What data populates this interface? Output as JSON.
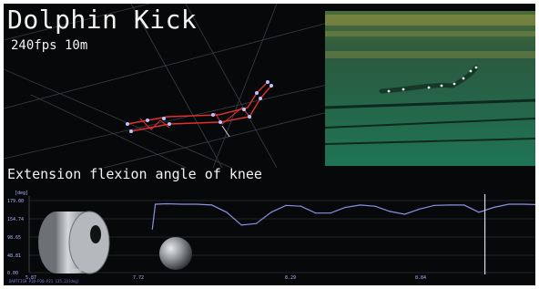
{
  "overlay": {
    "title": "Dolphin Kick",
    "subtitle": "240fps 10m",
    "section_label": "Extension flexion angle of knee"
  },
  "chart_data": {
    "type": "line",
    "ylabel": "[deg]",
    "y_ticks": [
      "179.00",
      "154.74",
      "98.65",
      "48.81",
      "0.00"
    ],
    "x_ticks": [
      "5.87",
      "7.72",
      "8.29",
      "8.84"
    ],
    "xlim": [
      5.87,
      9.28
    ],
    "ylim": [
      0,
      179
    ],
    "series": [
      {
        "x": [
          6.7,
          6.72,
          6.8,
          6.9,
          7.0,
          7.1,
          7.2,
          7.3,
          7.4,
          7.5,
          7.6,
          7.7,
          7.8,
          7.9,
          8.0,
          8.1,
          8.2,
          8.3,
          8.4,
          8.5,
          8.6,
          8.7,
          8.8,
          8.9,
          9.0,
          9.1,
          9.2,
          9.28
        ],
        "values": [
          108,
          170,
          171,
          170,
          170,
          168,
          150,
          118,
          122,
          150,
          167,
          165,
          148,
          148,
          162,
          168,
          165,
          152,
          145,
          158,
          167,
          168,
          168,
          150,
          162,
          170,
          170,
          169
        ]
      }
    ],
    "cursor_x": 8.94,
    "line_color": "#8a91e0"
  },
  "footer": {
    "text": "DARTFISH  P10-P20-P21   135.23[deg]"
  },
  "colors": {
    "background": "#07080a",
    "skeleton": "#e03030",
    "marker": "#b7c6ff",
    "grid": "#3a3d44",
    "water": "#1f6b50"
  }
}
